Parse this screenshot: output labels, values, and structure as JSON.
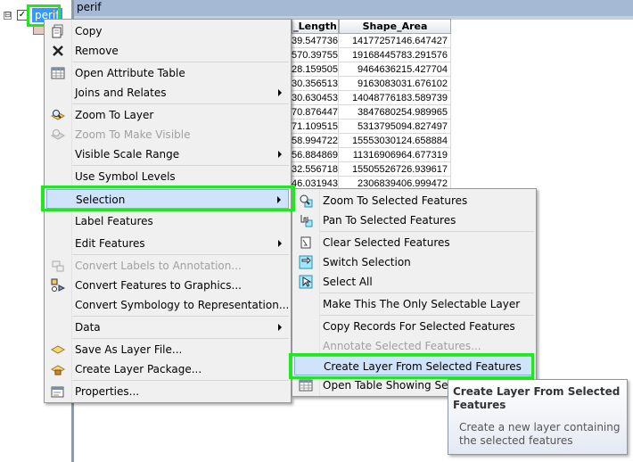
{
  "toc": {
    "expander": "⊟",
    "checkbox": "✓",
    "layer_name": "perif"
  },
  "table": {
    "title": "perif",
    "columns": [
      "_Length",
      "Shape_Area"
    ],
    "rows": [
      [
        "39.547736",
        "14177257146.647427"
      ],
      [
        "570.39755",
        "19168445783.291576"
      ],
      [
        "28.159505",
        "9464636215.427704"
      ],
      [
        "30.356513",
        "9163083031.676102"
      ],
      [
        "30.630453",
        "14048776183.589739"
      ],
      [
        "70.876447",
        "3847680254.989965"
      ],
      [
        "71.109515",
        "5313795094.827497"
      ],
      [
        "58.994722",
        "15553030124.658884"
      ],
      [
        "56.884869",
        "11316906964.677319"
      ],
      [
        "32.556718",
        "15505526726.939617"
      ],
      [
        "46.031943",
        "2306839406.999472"
      ]
    ]
  },
  "main_menu": {
    "items": [
      {
        "label": "Copy",
        "icon": "copy-icon",
        "enabled": true
      },
      {
        "label": "Remove",
        "icon": "remove-icon",
        "enabled": true
      },
      {
        "label": "Open Attribute Table",
        "icon": "table-icon",
        "enabled": true
      },
      {
        "label": "Joins and Relates",
        "icon": "",
        "enabled": true,
        "submenu": true
      },
      {
        "label": "Zoom To Layer",
        "icon": "zoom-layer-icon",
        "enabled": true
      },
      {
        "label": "Zoom To Make Visible",
        "icon": "zoom-visible-icon",
        "enabled": false
      },
      {
        "label": "Visible Scale Range",
        "icon": "",
        "enabled": true,
        "submenu": true
      },
      {
        "label": "Use Symbol Levels",
        "icon": "",
        "enabled": true
      },
      {
        "label": "Selection",
        "icon": "",
        "enabled": true,
        "submenu": true,
        "highlighted": true
      },
      {
        "label": "Label Features",
        "icon": "",
        "enabled": true
      },
      {
        "label": "Edit Features",
        "icon": "",
        "enabled": true,
        "submenu": true
      },
      {
        "label": "Convert Labels to Annotation...",
        "icon": "convert-labels-icon",
        "enabled": false
      },
      {
        "label": "Convert Features to Graphics...",
        "icon": "convert-graphics-icon",
        "enabled": true
      },
      {
        "label": "Convert Symbology to Representation...",
        "icon": "",
        "enabled": true
      },
      {
        "label": "Data",
        "icon": "",
        "enabled": true,
        "submenu": true
      },
      {
        "label": "Save As Layer File...",
        "icon": "layer-file-icon",
        "enabled": true
      },
      {
        "label": "Create Layer Package...",
        "icon": "layer-package-icon",
        "enabled": true
      },
      {
        "label": "Properties...",
        "icon": "properties-icon",
        "enabled": true
      }
    ]
  },
  "selection_menu": {
    "items": [
      {
        "label": "Zoom To Selected Features",
        "icon": "zoom-selected-icon",
        "enabled": true
      },
      {
        "label": "Pan To Selected Features",
        "icon": "pan-selected-icon",
        "enabled": true
      },
      {
        "label": "Clear Selected Features",
        "icon": "clear-selection-icon",
        "enabled": true
      },
      {
        "label": "Switch Selection",
        "icon": "switch-selection-icon",
        "enabled": true
      },
      {
        "label": "Select All",
        "icon": "select-all-icon",
        "enabled": true
      },
      {
        "label": "Make This The Only Selectable Layer",
        "icon": "",
        "enabled": true
      },
      {
        "label": "Copy Records For Selected Features",
        "icon": "",
        "enabled": true
      },
      {
        "label": "Annotate Selected Features...",
        "icon": "",
        "enabled": false
      },
      {
        "label": "Create Layer From Selected Features",
        "icon": "",
        "enabled": true,
        "highlighted": true
      },
      {
        "label": "Open Table Showing Selec",
        "icon": "table-icon",
        "enabled": true
      }
    ]
  },
  "tooltip": {
    "title": "Create Layer From Selected Features",
    "body": "Create a new layer containing the selected features"
  },
  "colors": {
    "highlight_outline": "#22e622",
    "menu_highlight": "#cfe3fb",
    "toc_selection": "#3399ff"
  }
}
